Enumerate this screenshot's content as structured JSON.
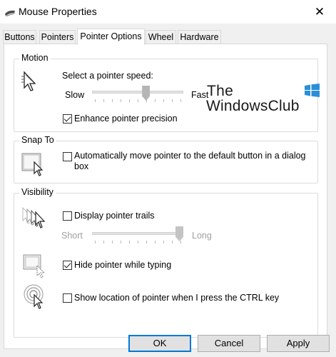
{
  "window": {
    "title": "Mouse Properties",
    "close_glyph": "✕",
    "icon": "mouse-icon"
  },
  "tabs": [
    {
      "label": "Buttons",
      "active": false
    },
    {
      "label": "Pointers",
      "active": false
    },
    {
      "label": "Pointer Options",
      "active": true
    },
    {
      "label": "Wheel",
      "active": false
    },
    {
      "label": "Hardware",
      "active": false
    }
  ],
  "motion": {
    "group_label": "Motion",
    "speed_label": "Select a pointer speed:",
    "slow_label": "Slow",
    "fast_label": "Fast",
    "speed_value_fraction": 0.6,
    "enhance_label": "Enhance pointer precision",
    "enhance_checked": true
  },
  "snap_to": {
    "group_label": "Snap To",
    "auto_move_label_line1": "Automatically move pointer to the default button in a dialog",
    "auto_move_label_line2": "box",
    "auto_move_checked": false
  },
  "visibility": {
    "group_label": "Visibility",
    "trails_label": "Display pointer trails",
    "trails_checked": false,
    "short_label": "Short",
    "long_label": "Long",
    "trails_length_fraction": 1.0,
    "hide_label": "Hide pointer while typing",
    "hide_checked": true,
    "show_location_label": "Show location of pointer when I press the CTRL key",
    "show_location_checked": false
  },
  "watermark": {
    "line1": "The",
    "line2": "WindowsClub"
  },
  "buttons": {
    "ok": "OK",
    "cancel": "Cancel",
    "apply": "Apply"
  },
  "colors": {
    "accent": "#0078d7",
    "panel_bg": "#ffffff",
    "window_bg": "#f0f0f0",
    "logo_blue": "#2b8fd8"
  }
}
